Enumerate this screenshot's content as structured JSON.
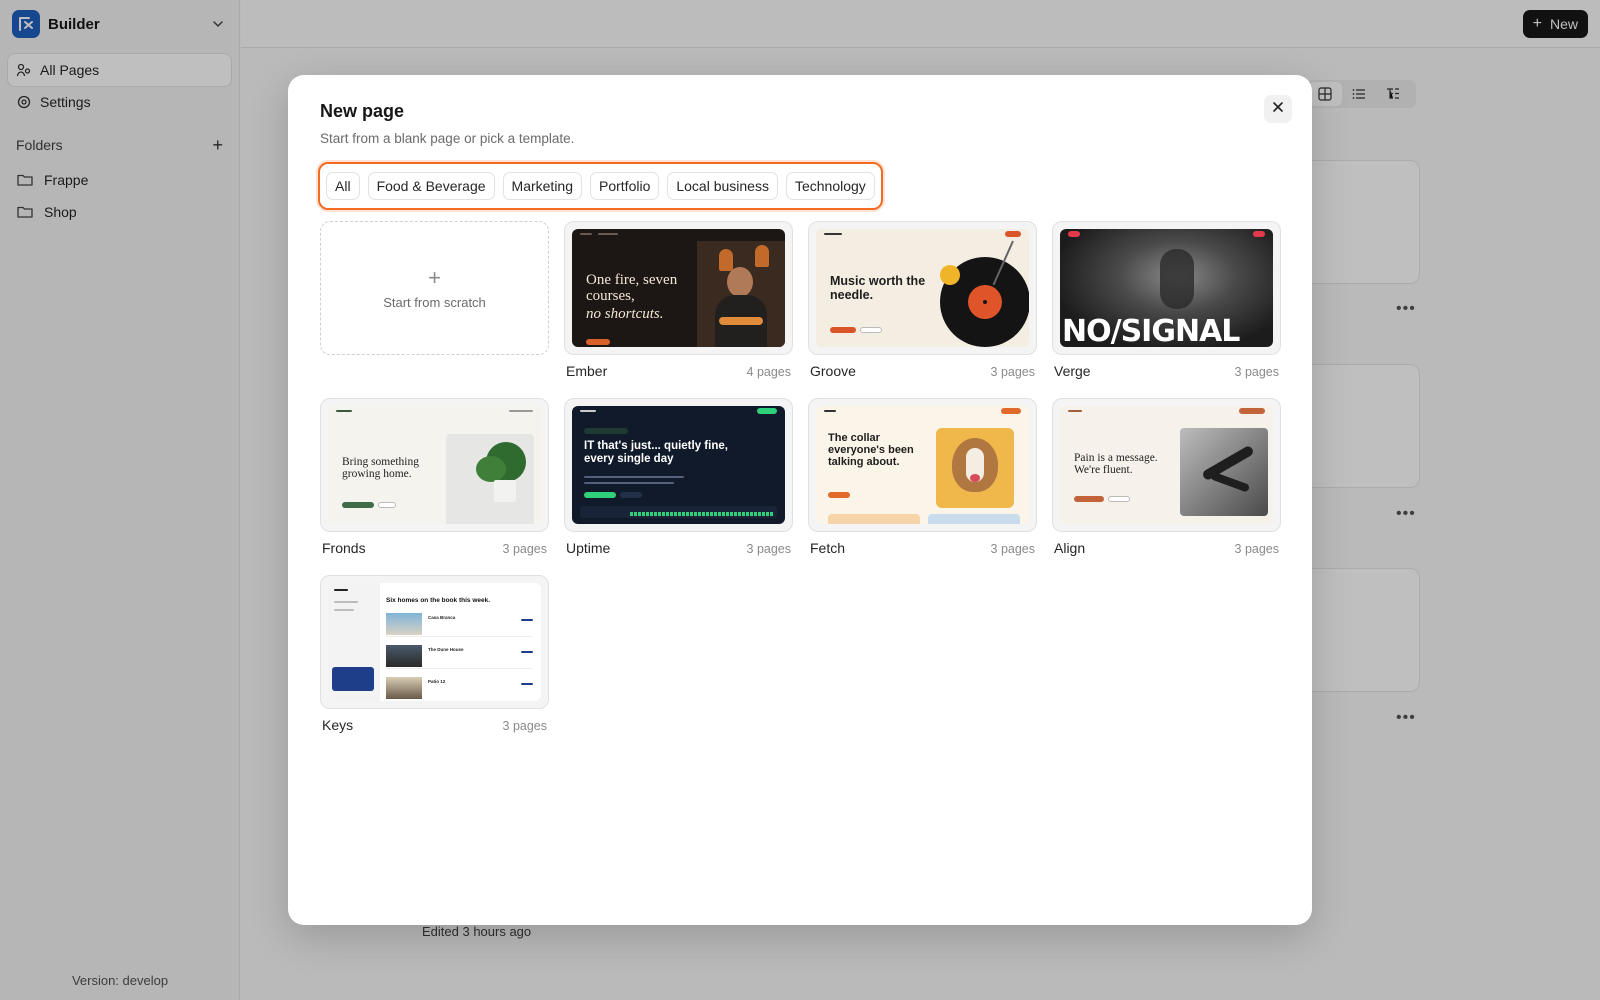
{
  "app": {
    "brand": "Builder",
    "nav": [
      {
        "label": "All Pages",
        "icon": "pages-icon",
        "active": true
      },
      {
        "label": "Settings",
        "icon": "gear-icon",
        "active": false
      }
    ],
    "folders_label": "Folders",
    "folders": [
      "Frappe",
      "Shop"
    ],
    "version": "Version: develop",
    "new_button": "New",
    "edited": "Edited 3 hours ago"
  },
  "modal": {
    "title": "New page",
    "subtitle": "Start from a blank page or pick a template.",
    "filters": [
      "All",
      "Food & Beverage",
      "Marketing",
      "Portfolio",
      "Local business",
      "Technology"
    ],
    "active_filter": "All",
    "scratch_label": "Start from scratch",
    "templates": [
      {
        "name": "Ember",
        "pages": "4 pages",
        "headline": "One fire, seven courses,",
        "headline_em": "no shortcuts."
      },
      {
        "name": "Groove",
        "pages": "3 pages",
        "headline": "Music worth the needle."
      },
      {
        "name": "Verge",
        "pages": "3 pages",
        "headline": "NO/SIGNAL"
      },
      {
        "name": "Fronds",
        "pages": "3 pages",
        "headline": "Bring something growing home."
      },
      {
        "name": "Uptime",
        "pages": "3 pages",
        "headline": "IT that's just... quietly fine, every single day"
      },
      {
        "name": "Fetch",
        "pages": "3 pages",
        "headline": "The collar everyone's been talking about."
      },
      {
        "name": "Align",
        "pages": "3 pages",
        "headline": "Pain is a message. We're fluent."
      },
      {
        "name": "Keys",
        "pages": "3 pages",
        "headline": "Six homes on the book this week.",
        "listings": [
          "Casa Branca",
          "The Dune House",
          "Patio 12"
        ]
      }
    ]
  },
  "colors": {
    "accent": "#f26b21",
    "brand": "#1f5fbf"
  }
}
